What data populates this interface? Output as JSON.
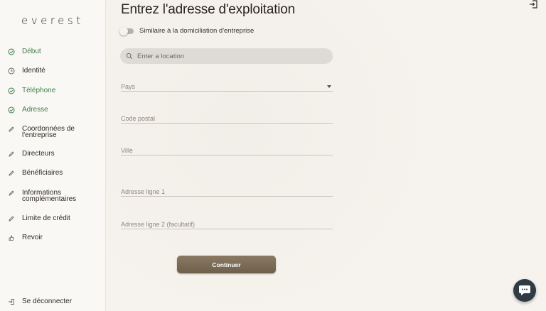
{
  "brand": {
    "logo": "everest"
  },
  "nav": {
    "items": [
      {
        "label": "Début",
        "icon": "check-circle-icon",
        "done": true
      },
      {
        "label": "Identité",
        "icon": "clock-icon",
        "done": false
      },
      {
        "label": "Téléphone",
        "icon": "check-circle-icon",
        "done": true
      },
      {
        "label": "Adresse",
        "icon": "check-circle-icon",
        "done": true
      },
      {
        "label": "Coordonnées de l'entreprise",
        "icon": "pencil-icon",
        "done": false
      },
      {
        "label": "Directeurs",
        "icon": "pencil-icon",
        "done": false
      },
      {
        "label": "Bénéficiaires",
        "icon": "pencil-icon",
        "done": false
      },
      {
        "label": "Informations complémentaires",
        "icon": "pencil-icon",
        "done": false
      },
      {
        "label": "Limite de crédit",
        "icon": "pencil-icon",
        "done": false
      },
      {
        "label": "Revoir",
        "icon": "thumbs-up-icon",
        "done": false
      }
    ],
    "logout": "Se déconnecter"
  },
  "form": {
    "title": "Entrez l'adresse d'exploitation",
    "toggle_label": "Similaire à la domiciliation d'entreprise",
    "toggle_on": false,
    "search_placeholder": "Enter a location",
    "fields": {
      "country": "Pays",
      "postal": "Code postal",
      "city": "Ville",
      "line1": "Adresse ligne 1",
      "line2": "Adresse ligne 2 (facultatif)"
    },
    "submit": "Continuer"
  },
  "colors": {
    "done_green": "#3c7d4a",
    "button_brown": "#7c6c56",
    "chat_bg": "#2f3c46"
  }
}
